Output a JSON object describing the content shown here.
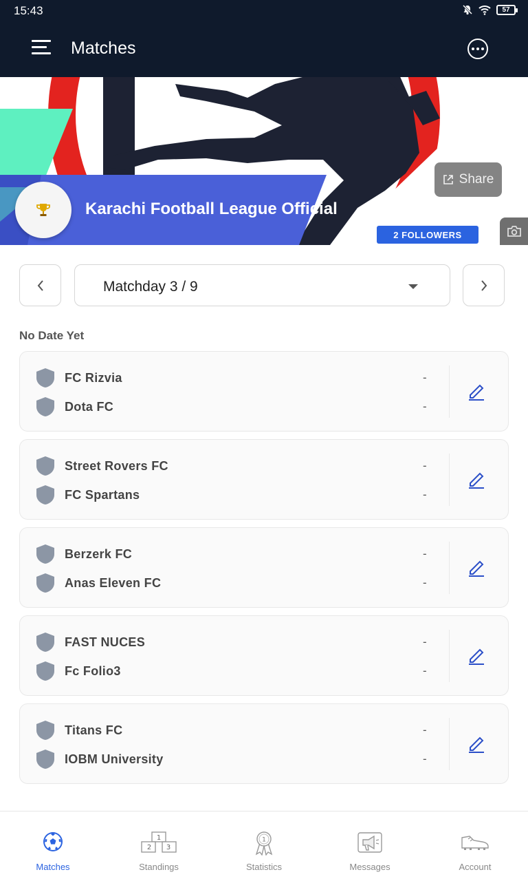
{
  "status_bar": {
    "time": "15:43",
    "battery": "57"
  },
  "app_bar": {
    "title": "Matches"
  },
  "league": {
    "name": "Karachi Football League Official",
    "followers": "2 FOLLOWERS",
    "share_label": "Share"
  },
  "matchday": {
    "label": "Matchday 3 / 9"
  },
  "section": {
    "label": "No Date Yet"
  },
  "matches": [
    {
      "home": "FC Rizvia",
      "home_score": "-",
      "away": "Dota FC",
      "away_score": "-"
    },
    {
      "home": "Street Rovers FC",
      "home_score": "-",
      "away": "FC Spartans",
      "away_score": "-"
    },
    {
      "home": "Berzerk FC",
      "home_score": "-",
      "away": "Anas Eleven FC",
      "away_score": "-"
    },
    {
      "home": "FAST NUCES",
      "home_score": "-",
      "away": "Fc Folio3",
      "away_score": "-"
    },
    {
      "home": "Titans FC",
      "home_score": "-",
      "away": "IOBM University",
      "away_score": "-"
    }
  ],
  "bottom_nav": [
    {
      "label": "Matches",
      "icon": "soccer-ball-icon",
      "active": true
    },
    {
      "label": "Standings",
      "icon": "podium-icon",
      "active": false
    },
    {
      "label": "Statistics",
      "icon": "medal-icon",
      "active": false
    },
    {
      "label": "Messages",
      "icon": "megaphone-icon",
      "active": false
    },
    {
      "label": "Account",
      "icon": "football-boot-icon",
      "active": false
    }
  ],
  "colors": {
    "app_bar": "#0f1a2c",
    "accent": "#2b63e0",
    "banner_red": "#e3231f",
    "banner_mint": "#5ef0c0",
    "banner_blue": "#4a60d8"
  }
}
